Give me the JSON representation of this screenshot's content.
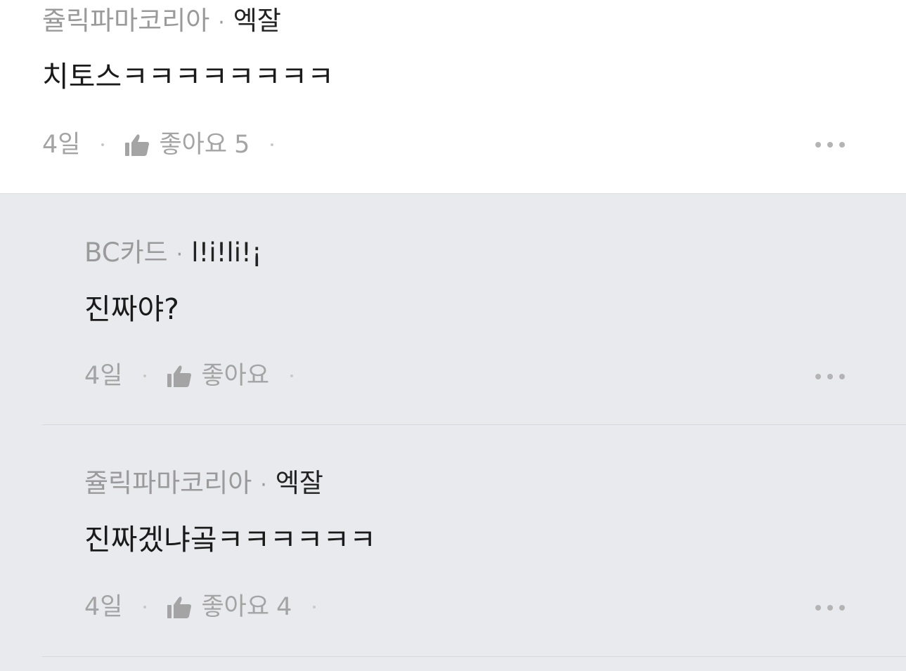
{
  "comments": [
    {
      "author": "쥴릭파마코리아",
      "separator": "·",
      "company": "엑잘",
      "body": "치토스ㅋㅋㅋㅋㅋㅋㅋㅋ",
      "time": "4일",
      "like_label": "좋아요",
      "like_count": "5"
    }
  ],
  "replies": [
    {
      "author": "BC카드",
      "separator": "·",
      "company": "l!i!li!¡",
      "body": "진짜야?",
      "time": "4일",
      "like_label": "좋아요",
      "like_count": ""
    },
    {
      "author": "쥴릭파마코리아",
      "separator": "·",
      "company": "엑잘",
      "body": "진짜겠냐곸ㅋㅋㅋㅋㅋㅋ",
      "time": "4일",
      "like_label": "좋아요",
      "like_count": "4"
    }
  ],
  "icons": {
    "like": "thumbs-up-icon",
    "more": "more-horizontal-icon"
  },
  "colors": {
    "reply_background": "#e9eaee",
    "muted_text": "#9a9a9a",
    "primary_text": "#1a1a1a"
  }
}
